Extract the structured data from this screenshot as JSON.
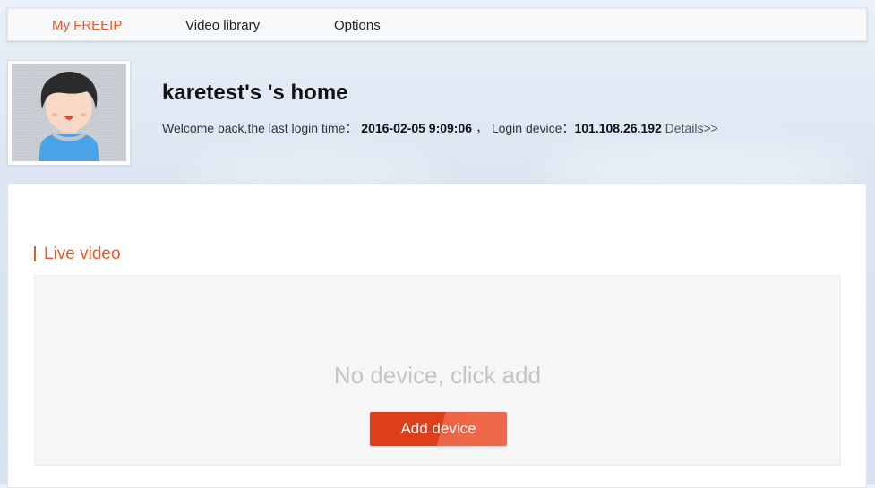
{
  "nav": {
    "items": [
      {
        "label": "My FREEIP",
        "active": true
      },
      {
        "label": "Video library",
        "active": false
      },
      {
        "label": "Options",
        "active": false
      }
    ]
  },
  "profile": {
    "title": "karetest's 's home",
    "welcome_prefix": "Welcome back,the last login time：",
    "last_login_time": "2016-02-05 9:09:06",
    "separator": "，",
    "device_prefix": "Login device：",
    "login_device": "101.108.26.192",
    "details_link": "Details>>"
  },
  "live": {
    "section_title": "Live video",
    "empty_message": "No device, click add",
    "add_button": "Add device"
  },
  "colors": {
    "accent": "#e8582a",
    "button": "#df3e1b"
  }
}
